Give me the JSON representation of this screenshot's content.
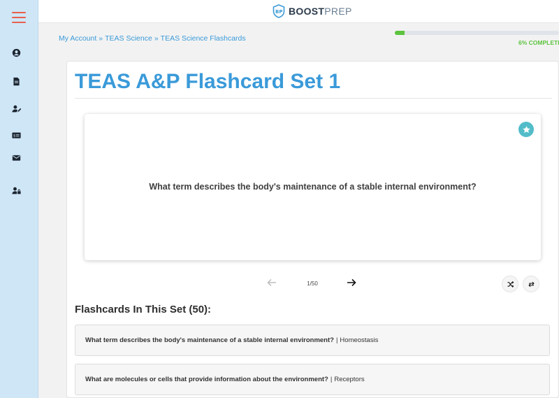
{
  "header": {
    "logo_bold": "BOOST",
    "logo_light": "PREP",
    "brand_color": "#2b3a4a"
  },
  "sidebar": {
    "menu_icon": "hamburger-menu-icon",
    "items": [
      {
        "icon": "account-icon"
      },
      {
        "icon": "document-icon"
      },
      {
        "icon": "user-edit-icon"
      },
      {
        "icon": "billing-icon"
      },
      {
        "icon": "mail-icon"
      },
      {
        "icon": "user-lock-icon"
      }
    ]
  },
  "breadcrumb": {
    "items": [
      "My Account",
      "TEAS Science",
      "TEAS Science Flashcards"
    ],
    "separator": "»"
  },
  "progress": {
    "percent": 6,
    "label": "6% COMPLETE"
  },
  "page": {
    "title": "TEAS A&P Flashcard Set 1"
  },
  "flashcard": {
    "question": "What term describes the body's maintenance of a stable internal environment?",
    "favorite_icon": "star-icon"
  },
  "navigation": {
    "counter": "1/50",
    "prev_icon": "arrow-left-icon",
    "next_icon": "arrow-right-icon",
    "shuffle_icon": "shuffle-icon",
    "flip_icon": "swap-icon"
  },
  "list": {
    "heading": "Flashcards In This Set (50):",
    "items": [
      {
        "question": "What term describes the body's maintenance of a stable internal environment?",
        "answer": "Homeostasis"
      },
      {
        "question": "What are molecules or cells that provide information about the environment?",
        "answer": "Receptors"
      }
    ]
  },
  "colors": {
    "accent": "#3a9ad9",
    "progress": "#5cc33e",
    "star": "#53bcc9",
    "menu": "#e8604c",
    "sidebar": "#cfe6f7"
  }
}
